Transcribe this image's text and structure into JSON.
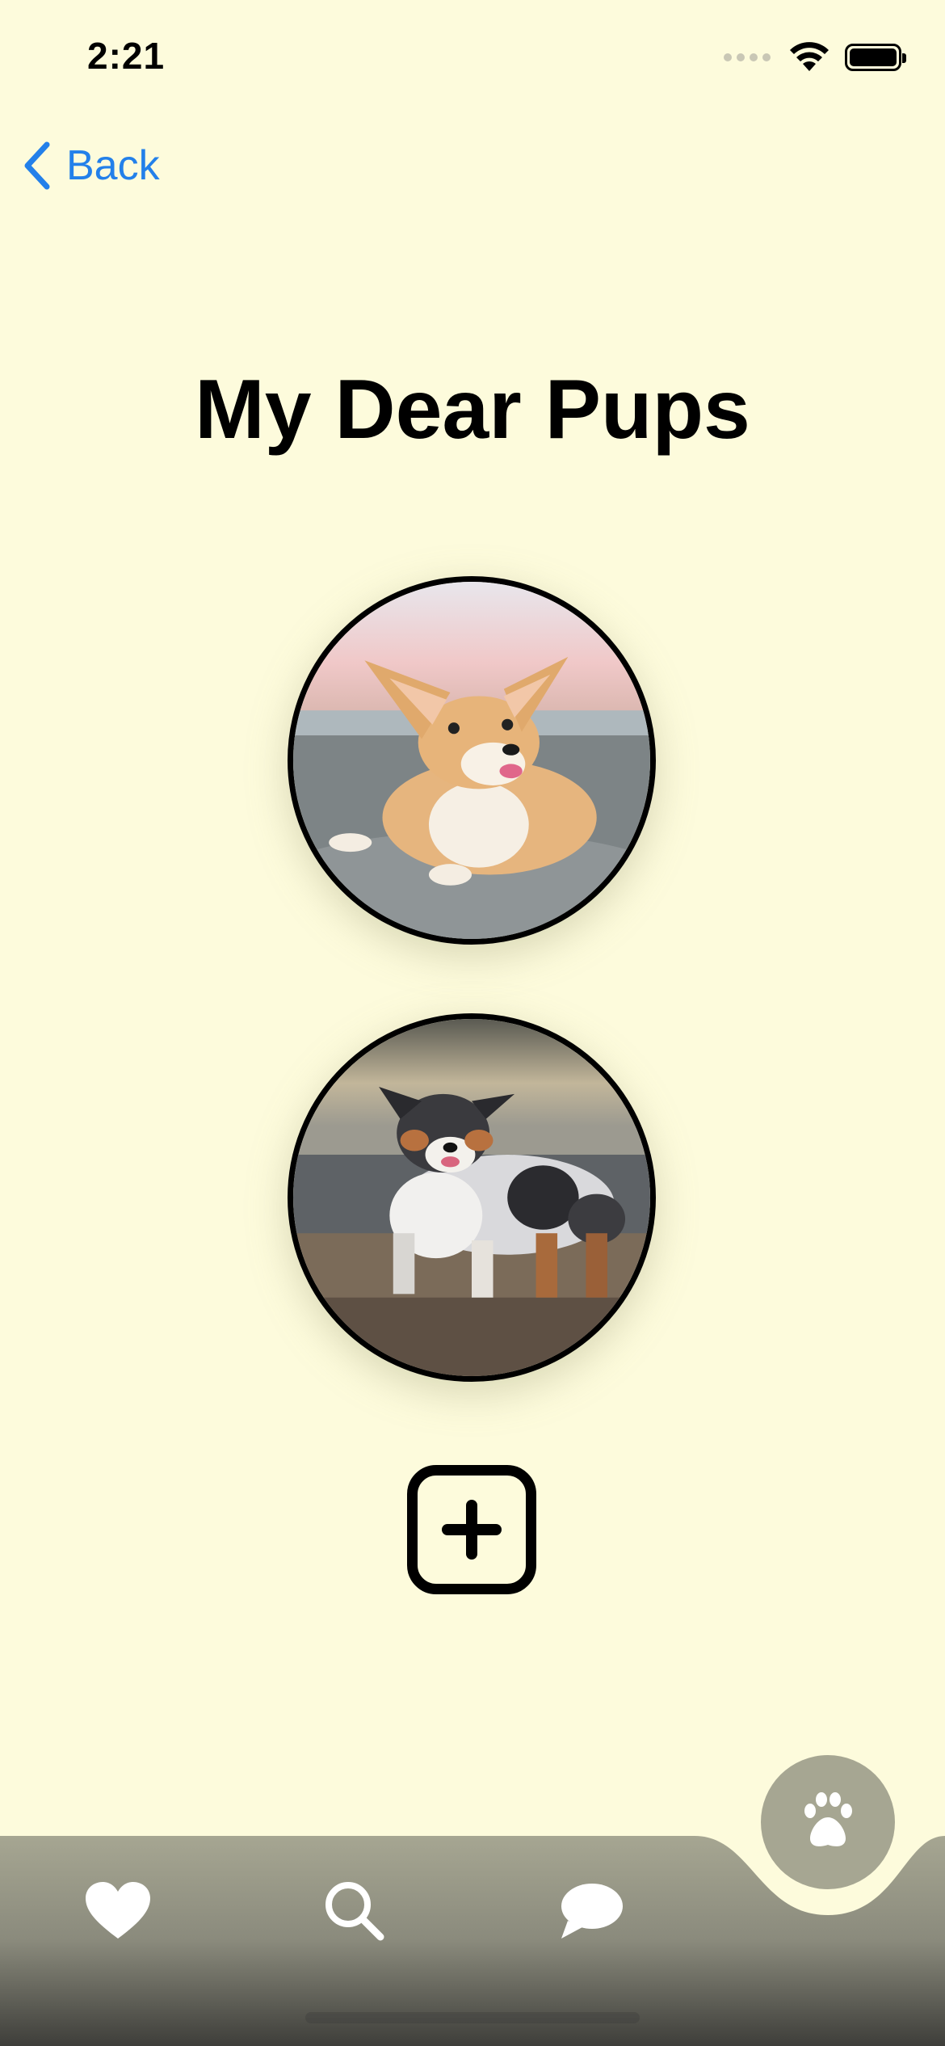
{
  "status_bar": {
    "time": "2:21"
  },
  "nav": {
    "back_label": "Back"
  },
  "page": {
    "title": "My Dear Pups"
  },
  "pups": [
    {
      "name": "corgi-photo"
    },
    {
      "name": "australian-shepherd-photo"
    }
  ],
  "colors": {
    "background": "#FDFBDC",
    "accent": "#2380EA",
    "tabbar_top": "#A6A692",
    "tabbar_bottom": "#3E3E3A"
  },
  "tabbar": {
    "items": [
      {
        "icon": "heart-icon"
      },
      {
        "icon": "search-icon"
      },
      {
        "icon": "chat-icon"
      },
      {
        "icon": "paw-icon",
        "selected": true
      }
    ]
  }
}
